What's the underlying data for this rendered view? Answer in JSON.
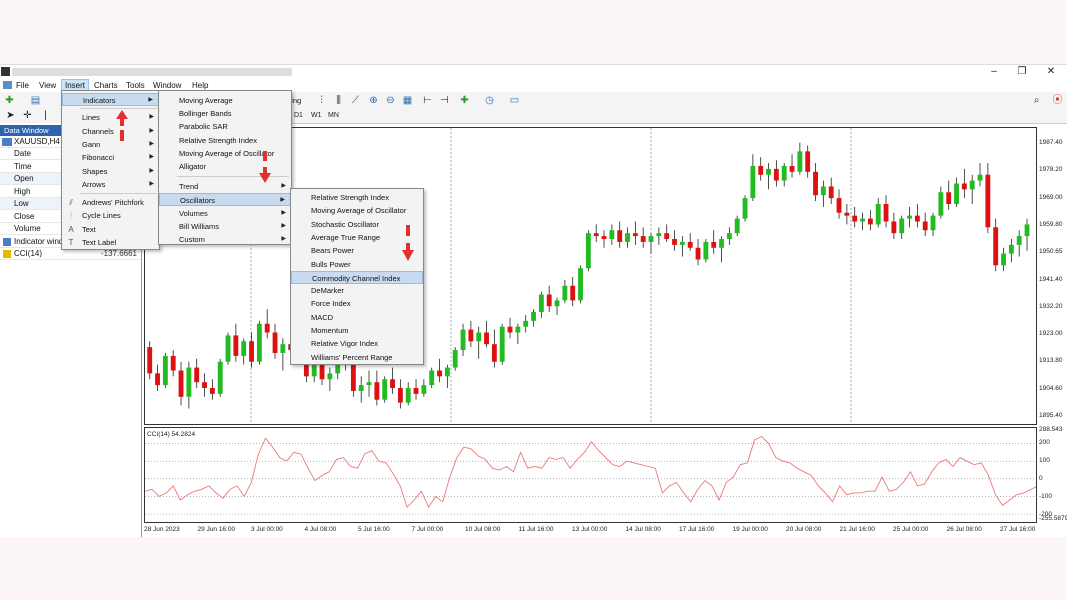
{
  "window": {
    "title_blurred": "",
    "controls": {
      "minimize": "–",
      "maximize": "❐",
      "close": "✕"
    }
  },
  "menubar": [
    "File",
    "View",
    "Insert",
    "Charts",
    "Tools",
    "Window",
    "Help"
  ],
  "toolbar": {
    "trading_label": "ding"
  },
  "timeframes": [
    "D1",
    "W1",
    "MN"
  ],
  "data_window": {
    "title": "Data Window",
    "symbol": "XAUUSD,H4",
    "rows": [
      {
        "label": "Date",
        "value": ""
      },
      {
        "label": "Time",
        "value": ""
      },
      {
        "label": "Open",
        "value": ""
      },
      {
        "label": "High",
        "value": ""
      },
      {
        "label": "Low",
        "value": ""
      },
      {
        "label": "Close",
        "value": ""
      },
      {
        "label": "Volume",
        "value": ""
      },
      {
        "label": "Indicator wind",
        "value": ""
      },
      {
        "label": "CCI(14)",
        "value": "-137.6661"
      }
    ]
  },
  "insert_menu": {
    "items": [
      {
        "label": "Indicators",
        "arrow": true,
        "highlight": true
      },
      {
        "label": "Lines",
        "arrow": true
      },
      {
        "label": "Channels",
        "arrow": true
      },
      {
        "label": "Gann",
        "arrow": true
      },
      {
        "label": "Fibonacci",
        "arrow": true
      },
      {
        "label": "Shapes",
        "arrow": true
      },
      {
        "label": "Arrows",
        "arrow": true
      },
      {
        "label": "Andrews' Pitchfork",
        "icon": "pitchfork-icon"
      },
      {
        "label": "Cycle Lines",
        "icon": "cycle-lines-icon"
      },
      {
        "label": "Text",
        "icon": "text-icon"
      },
      {
        "label": "Text Label",
        "icon": "text-label-icon"
      }
    ]
  },
  "indicators_menu": {
    "items": [
      {
        "label": "Moving Average"
      },
      {
        "label": "Bollinger Bands"
      },
      {
        "label": "Parabolic SAR"
      },
      {
        "label": "Relative Strength Index"
      },
      {
        "label": "Moving Average of Oscillator"
      },
      {
        "label": "Alligator"
      },
      {
        "label": "Trend",
        "arrow": true
      },
      {
        "label": "Oscillators",
        "arrow": true,
        "highlight": true
      },
      {
        "label": "Volumes",
        "arrow": true
      },
      {
        "label": "Bill Williams",
        "arrow": true
      },
      {
        "label": "Custom",
        "arrow": true
      }
    ]
  },
  "oscillators_menu": {
    "items": [
      {
        "label": "Relative Strength Index"
      },
      {
        "label": "Moving Average of Oscillator"
      },
      {
        "label": "Stochastic Oscillator"
      },
      {
        "label": "Average True Range"
      },
      {
        "label": "Bears Power"
      },
      {
        "label": "Bulls Power"
      },
      {
        "label": "Commodity Channel Index",
        "highlight": true
      },
      {
        "label": "DeMarker"
      },
      {
        "label": "Force Index"
      },
      {
        "label": "MACD"
      },
      {
        "label": "Momentum"
      },
      {
        "label": "Relative Vigor Index"
      },
      {
        "label": "Williams' Percent Range"
      }
    ]
  },
  "price_scale": [
    "1987.40",
    "1978.20",
    "1969.00",
    "1959.80",
    "1950.65",
    "1941.40",
    "1932.20",
    "1923.00",
    "1913.80",
    "1904.60",
    "1895.40"
  ],
  "cci_label": "CCI(14) 54.2824",
  "cci_scale": [
    "288.543",
    "200",
    "100",
    "0",
    "-100",
    "-200",
    "-255.5879"
  ],
  "time_axis": [
    "28 Jun 2023",
    "29 Jun 16:00",
    "3 Jul 00:00",
    "4 Jul 08:00",
    "5 Jul 16:00",
    "7 Jul 00:00",
    "10 Jul 08:00",
    "11 Jul 16:00",
    "13 Jul 00:00",
    "14 Jul 08:00",
    "17 Jul 16:00",
    "19 Jul 00:00",
    "20 Jul 08:00",
    "21 Jul 16:00",
    "25 Jul 00:00",
    "26 Jul 08:00",
    "27 Jul 16:00"
  ],
  "colors": {
    "bull": "#22bb22",
    "bear": "#dd1111",
    "cci_line": "#ee7777",
    "menu_highlight": "#c7daf0",
    "header_blue": "#2e63b0",
    "arrow_red": "#e03030"
  },
  "candles": [
    [
      1917,
      1919,
      1906,
      1908
    ],
    [
      1908,
      1911,
      1902,
      1904
    ],
    [
      1904,
      1915,
      1903,
      1914
    ],
    [
      1914,
      1916,
      1907,
      1909
    ],
    [
      1909,
      1912,
      1897,
      1900
    ],
    [
      1900,
      1912,
      1896,
      1910
    ],
    [
      1910,
      1913,
      1903,
      1905
    ],
    [
      1905,
      1908,
      1900,
      1903
    ],
    [
      1903,
      1906,
      1899,
      1901
    ],
    [
      1901,
      1913,
      1900,
      1912
    ],
    [
      1912,
      1922,
      1911,
      1921
    ],
    [
      1921,
      1925,
      1912,
      1914
    ],
    [
      1914,
      1920,
      1911,
      1919
    ],
    [
      1919,
      1922,
      1910,
      1912
    ],
    [
      1912,
      1926,
      1911,
      1925
    ],
    [
      1925,
      1930,
      1920,
      1922
    ],
    [
      1922,
      1925,
      1913,
      1915
    ],
    [
      1915,
      1920,
      1909,
      1918
    ],
    [
      1918,
      1921,
      1914,
      1916
    ],
    [
      1916,
      1920,
      1912,
      1913
    ],
    [
      1913,
      1917,
      1905,
      1907
    ],
    [
      1907,
      1913,
      1905,
      1912
    ],
    [
      1912,
      1916,
      1904,
      1906
    ],
    [
      1906,
      1910,
      1902,
      1908
    ],
    [
      1908,
      1914,
      1906,
      1913
    ],
    [
      1913,
      1918,
      1909,
      1911
    ],
    [
      1911,
      1913,
      1900,
      1902
    ],
    [
      1902,
      1907,
      1898,
      1904
    ],
    [
      1904,
      1909,
      1900,
      1905
    ],
    [
      1905,
      1909,
      1897,
      1899
    ],
    [
      1899,
      1907,
      1898,
      1906
    ],
    [
      1906,
      1910,
      1901,
      1903
    ],
    [
      1903,
      1906,
      1896,
      1898
    ],
    [
      1898,
      1905,
      1897,
      1903
    ],
    [
      1903,
      1906,
      1899,
      1901
    ],
    [
      1901,
      1906,
      1900,
      1904
    ],
    [
      1904,
      1910,
      1903,
      1909
    ],
    [
      1909,
      1913,
      1905,
      1907
    ],
    [
      1907,
      1911,
      1903,
      1910
    ],
    [
      1910,
      1917,
      1909,
      1916
    ],
    [
      1916,
      1925,
      1914,
      1923
    ],
    [
      1923,
      1926,
      1917,
      1919
    ],
    [
      1919,
      1924,
      1913,
      1922
    ],
    [
      1922,
      1926,
      1917,
      1918
    ],
    [
      1918,
      1923,
      1910,
      1912
    ],
    [
      1912,
      1925,
      1911,
      1924
    ],
    [
      1924,
      1927,
      1920,
      1922
    ],
    [
      1922,
      1925,
      1918,
      1924
    ],
    [
      1924,
      1928,
      1922,
      1926
    ],
    [
      1926,
      1930,
      1924,
      1929
    ],
    [
      1929,
      1936,
      1927,
      1935
    ],
    [
      1935,
      1938,
      1929,
      1931
    ],
    [
      1931,
      1934,
      1928,
      1933
    ],
    [
      1933,
      1940,
      1932,
      1938
    ],
    [
      1938,
      1941,
      1931,
      1933
    ],
    [
      1933,
      1945,
      1932,
      1944
    ],
    [
      1944,
      1957,
      1943,
      1956
    ],
    [
      1956,
      1959,
      1953,
      1955
    ],
    [
      1955,
      1957,
      1951,
      1954
    ],
    [
      1954,
      1959,
      1952,
      1957
    ],
    [
      1957,
      1960,
      1951,
      1953
    ],
    [
      1953,
      1958,
      1951,
      1956
    ],
    [
      1956,
      1960,
      1952,
      1955
    ],
    [
      1955,
      1958,
      1951,
      1953
    ],
    [
      1953,
      1956,
      1949,
      1955
    ],
    [
      1955,
      1958,
      1952,
      1956
    ],
    [
      1956,
      1959,
      1953,
      1954
    ],
    [
      1954,
      1957,
      1950,
      1952
    ],
    [
      1952,
      1955,
      1948,
      1953
    ],
    [
      1953,
      1956,
      1950,
      1951
    ],
    [
      1951,
      1954,
      1945,
      1947
    ],
    [
      1947,
      1954,
      1946,
      1953
    ],
    [
      1953,
      1957,
      1949,
      1951
    ],
    [
      1951,
      1955,
      1946,
      1954
    ],
    [
      1954,
      1958,
      1952,
      1956
    ],
    [
      1956,
      1962,
      1955,
      1961
    ],
    [
      1961,
      1969,
      1960,
      1968
    ],
    [
      1968,
      1983,
      1967,
      1979
    ],
    [
      1979,
      1982,
      1974,
      1976
    ],
    [
      1976,
      1980,
      1971,
      1978
    ],
    [
      1978,
      1981,
      1972,
      1974
    ],
    [
      1974,
      1980,
      1972,
      1979
    ],
    [
      1979,
      1983,
      1975,
      1977
    ],
    [
      1977,
      1987,
      1976,
      1984
    ],
    [
      1984,
      1986,
      1975,
      1977
    ],
    [
      1977,
      1980,
      1967,
      1969
    ],
    [
      1969,
      1974,
      1965,
      1972
    ],
    [
      1972,
      1975,
      1966,
      1968
    ],
    [
      1968,
      1971,
      1961,
      1963
    ],
    [
      1963,
      1966,
      1959,
      1962
    ],
    [
      1962,
      1965,
      1958,
      1960
    ],
    [
      1960,
      1963,
      1957,
      1961
    ],
    [
      1961,
      1964,
      1957,
      1959
    ],
    [
      1959,
      1968,
      1958,
      1966
    ],
    [
      1966,
      1969,
      1958,
      1960
    ],
    [
      1960,
      1963,
      1954,
      1956
    ],
    [
      1956,
      1962,
      1954,
      1961
    ],
    [
      1961,
      1965,
      1958,
      1962
    ],
    [
      1962,
      1966,
      1958,
      1960
    ],
    [
      1960,
      1963,
      1955,
      1957
    ],
    [
      1957,
      1963,
      1955,
      1962
    ],
    [
      1962,
      1972,
      1961,
      1970
    ],
    [
      1970,
      1974,
      1964,
      1966
    ],
    [
      1966,
      1975,
      1965,
      1973
    ],
    [
      1973,
      1978,
      1968,
      1971
    ],
    [
      1971,
      1976,
      1966,
      1974
    ],
    [
      1974,
      1980,
      1972,
      1976
    ],
    [
      1976,
      1980,
      1956,
      1958
    ],
    [
      1958,
      1961,
      1943,
      1945
    ],
    [
      1945,
      1951,
      1943,
      1949
    ],
    [
      1949,
      1954,
      1946,
      1952
    ],
    [
      1952,
      1957,
      1948,
      1955
    ],
    [
      1955,
      1961,
      1950,
      1959
    ]
  ],
  "cci_values": [
    -70,
    -60,
    -100,
    -80,
    -40,
    -120,
    -90,
    -70,
    -60,
    -40,
    -80,
    -110,
    -60,
    -40,
    -100,
    -20,
    140,
    230,
    180,
    120,
    100,
    150,
    140,
    60,
    -10,
    20,
    40,
    110,
    120,
    70,
    60,
    140,
    160,
    100,
    90,
    30,
    -40,
    -160,
    -120,
    -70,
    -160,
    -100,
    -130,
    10,
    120,
    180,
    170,
    130,
    110,
    60,
    50,
    70,
    40,
    150,
    60,
    70,
    60,
    120,
    110,
    120,
    60,
    110,
    150,
    210,
    160,
    120,
    80,
    70,
    100,
    90,
    80,
    70,
    60,
    -80,
    -40,
    -20,
    -80,
    -130,
    -60,
    -10,
    -40,
    -120,
    -20,
    10,
    80,
    90,
    220,
    240,
    200,
    120,
    100,
    90,
    60,
    40,
    20,
    -40,
    -80,
    -130,
    -40,
    -90,
    -80,
    -80,
    -70,
    -70,
    10,
    -70,
    -60,
    -20,
    40,
    -40,
    -30,
    40,
    90,
    110,
    70,
    120,
    100,
    80,
    90,
    20,
    -90,
    -150,
    -120,
    -90,
    -80,
    -60,
    -40
  ]
}
